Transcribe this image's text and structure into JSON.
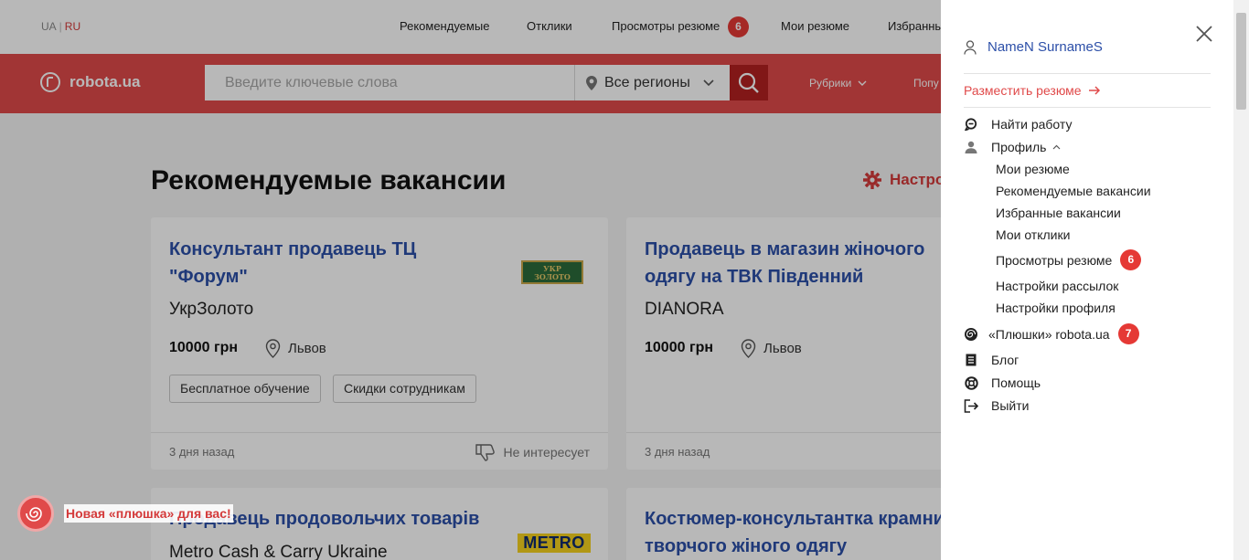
{
  "lang": {
    "ua": "UA",
    "sep": "|",
    "ru": "RU"
  },
  "topnav": {
    "recommended": "Рекомендуемые",
    "responses": "Отклики",
    "resume_views": "Просмотры резюме",
    "resume_views_count": "6",
    "my_resumes": "Мои резюме",
    "favorites": "Избранны"
  },
  "header": {
    "logo_text": "robota.ua",
    "search_placeholder": "Введите ключевые слова",
    "region": "Все регионы",
    "rubrics": "Рубрики",
    "popular": "Попу"
  },
  "main": {
    "heading": "Рекомендуемые вакансии",
    "settings_label": "Настро"
  },
  "cards": [
    {
      "title_line1": "Консультант продавець ТЦ",
      "title_line2": "\"Форум\"",
      "company": "УкрЗолото",
      "logo_line1": "УКР",
      "logo_line2": "ЗОЛОТО",
      "salary": "10000 грн",
      "city": "Львов",
      "tags": [
        "Бесплатное обучение",
        "Скидки сотрудникам"
      ],
      "date": "3 дня назад",
      "not_interested": "Не интересует"
    },
    {
      "title_line1": "Продавець в магазин жіночого",
      "title_line2": "одягу на ТВК Південний",
      "company": "DIANORA",
      "salary": "10000 грн",
      "city": "Львов",
      "date": "3 дня назад"
    },
    {
      "title_line1": "Продавець продовольчих товарів",
      "company": "Metro Cash & Carry Ukraine",
      "logo_text": "METRO"
    },
    {
      "title_line1": "Костюмер-консультантка крамни",
      "title_line2": "творчого жіного одягу"
    }
  ],
  "promo": {
    "text": "Новая «плюшка» для вас!"
  },
  "panel": {
    "user_name": "NameN SurnameS",
    "post_resume": "Разместить резюме",
    "find_job": "Найти работу",
    "profile": "Профиль",
    "profile_items": {
      "my_resumes": "Мои резюме",
      "recommended": "Рекомендуемые вакансии",
      "favorites": "Избранные вакансии",
      "responses": "Мои отклики",
      "resume_views": "Просмотры резюме",
      "resume_views_count": "6",
      "mailing_settings": "Настройки рассылок",
      "profile_settings": "Настройки профиля"
    },
    "bonuses": "«Плюшки» robota.ua",
    "bonuses_count": "7",
    "blog": "Блог",
    "help": "Помощь",
    "logout": "Выйти"
  },
  "colors": {
    "brand_red": "#e04a4a",
    "link_blue": "#2c4fa8",
    "badge_red": "#e53935"
  }
}
